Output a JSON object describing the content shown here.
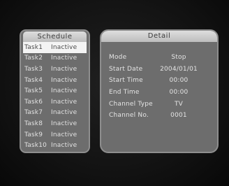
{
  "schedule": {
    "title": "Schedule",
    "tasks": [
      {
        "name": "Task1",
        "status": "Inactive"
      },
      {
        "name": "Task2",
        "status": "Inactive"
      },
      {
        "name": "Task3",
        "status": "Inactive"
      },
      {
        "name": "Task4",
        "status": "Inactive"
      },
      {
        "name": "Task5",
        "status": "Inactive"
      },
      {
        "name": "Task6",
        "status": "Inactive"
      },
      {
        "name": "Task7",
        "status": "Inactive"
      },
      {
        "name": "Task8",
        "status": "Inactive"
      },
      {
        "name": "Task9",
        "status": "Inactive"
      },
      {
        "name": "Task10",
        "status": "Inactive"
      }
    ],
    "selected_index": 0
  },
  "detail": {
    "title": "Detail",
    "fields": [
      {
        "label": "Mode",
        "value": "Stop"
      },
      {
        "label": "Start Date",
        "value": "2004/01/01"
      },
      {
        "label": "Start Time",
        "value": "00:00"
      },
      {
        "label": "End Time",
        "value": "00:00"
      },
      {
        "label": "Channel Type",
        "value": "TV"
      },
      {
        "label": "Channel No.",
        "value": "0001"
      }
    ]
  },
  "colors": {
    "panel": "#6d6d6d",
    "panel_border": "#8e8e8e",
    "header": "#d0d0d0",
    "selection": "#f4f4f4",
    "background": "#141414"
  }
}
